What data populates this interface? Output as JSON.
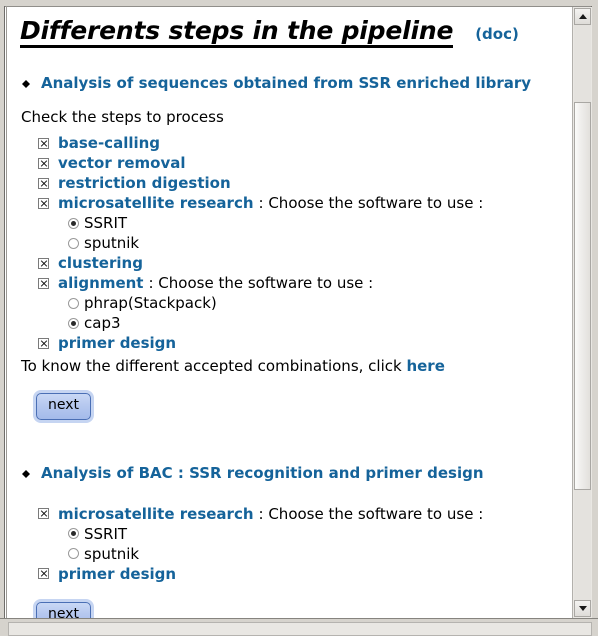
{
  "header": {
    "title": "Differents steps in the pipeline",
    "doc_link": "(doc)"
  },
  "section1": {
    "heading": "Analysis of sequences obtained from SSR enriched library",
    "instruction": "Check the steps to process",
    "steps": [
      {
        "label": "base-calling",
        "suffix": "",
        "checked": true
      },
      {
        "label": "vector removal",
        "suffix": "",
        "checked": true
      },
      {
        "label": "restriction digestion",
        "suffix": "",
        "checked": true
      },
      {
        "label": "microsatellite research",
        "suffix": ": Choose the software to use :",
        "checked": true
      },
      {
        "label": "clustering",
        "suffix": "",
        "checked": true
      },
      {
        "label": "alignment",
        "suffix": ": Choose the software to use :",
        "checked": true
      },
      {
        "label": "primer design",
        "suffix": "",
        "checked": true
      }
    ],
    "microsat_options": [
      {
        "label": "SSRIT",
        "selected": true
      },
      {
        "label": "sputnik",
        "selected": false
      }
    ],
    "alignment_options": [
      {
        "label": "phrap(Stackpack)",
        "selected": false
      },
      {
        "label": "cap3",
        "selected": true
      }
    ],
    "footnote_prefix": "To know the different accepted combinations, click ",
    "footnote_link": "here",
    "next_label": "next"
  },
  "section2": {
    "heading": "Analysis of BAC : SSR recognition and primer design",
    "steps": [
      {
        "label": "microsatellite research",
        "suffix": ": Choose the software to use :",
        "checked": true
      },
      {
        "label": "primer design",
        "suffix": "",
        "checked": true
      }
    ],
    "microsat_options": [
      {
        "label": "SSRIT",
        "selected": true
      },
      {
        "label": "sputnik",
        "selected": false
      }
    ],
    "next_label": "next"
  },
  "colors": {
    "link_blue": "#15639a",
    "text_black": "#000000",
    "button_border": "#4a6fb5"
  }
}
